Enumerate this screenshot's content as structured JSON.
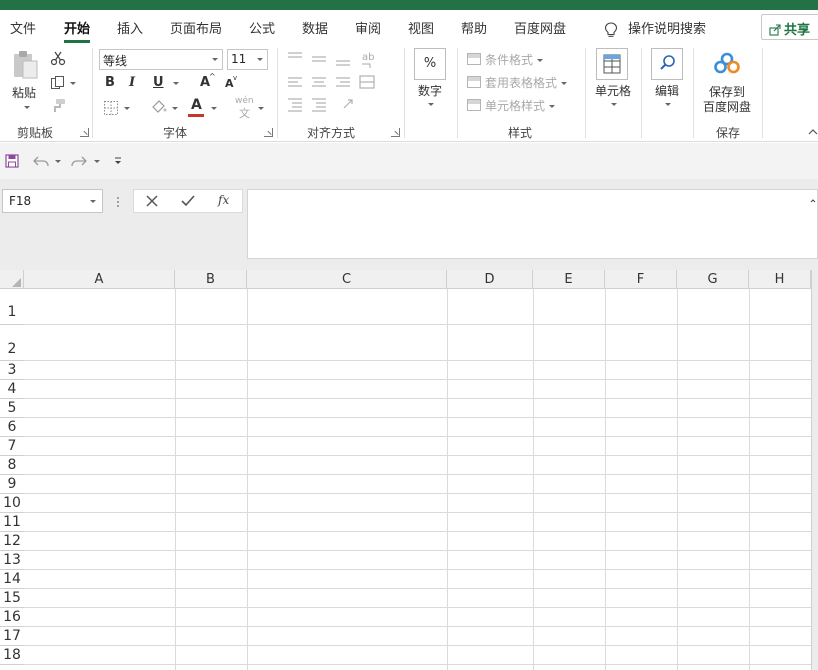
{
  "menu": {
    "tabs": [
      "文件",
      "开始",
      "插入",
      "页面布局",
      "公式",
      "数据",
      "审阅",
      "视图",
      "帮助",
      "百度网盘"
    ],
    "active_tab": "开始",
    "tell_me": "操作说明搜索",
    "share": "共享"
  },
  "ribbon": {
    "clipboard": {
      "paste": "粘贴",
      "label": "剪贴板"
    },
    "font": {
      "name": "等线",
      "size": "11",
      "bold": "B",
      "italic": "I",
      "underline": "U",
      "grow": "A",
      "shrink": "A",
      "font_color": "A",
      "phonetic": "wén",
      "phonetic_char": "文",
      "label": "字体"
    },
    "alignment": {
      "label": "对齐方式"
    },
    "number": {
      "symbol": "%",
      "label": "数字"
    },
    "styles": {
      "conditional": "条件格式",
      "table": "套用表格格式",
      "cell_styles": "单元格样式",
      "label": "样式"
    },
    "cells": {
      "label": "单元格"
    },
    "editing": {
      "label": "编辑"
    },
    "save": {
      "line1": "保存到",
      "line2": "百度网盘",
      "label": "保存"
    }
  },
  "formula_bar": {
    "name_box": "F18",
    "fx": "fx",
    "value": ""
  },
  "sheet": {
    "columns": [
      "A",
      "B",
      "C",
      "D",
      "E",
      "F",
      "G",
      "H"
    ],
    "rows": [
      "1",
      "2",
      "3",
      "4",
      "5",
      "6",
      "7",
      "8",
      "9",
      "10",
      "11",
      "12",
      "13",
      "14",
      "15",
      "16",
      "17",
      "18"
    ]
  },
  "colors": {
    "accent": "#217346",
    "font_color_bar": "#c0392b",
    "baidu_blue": "#3b8fd9"
  }
}
